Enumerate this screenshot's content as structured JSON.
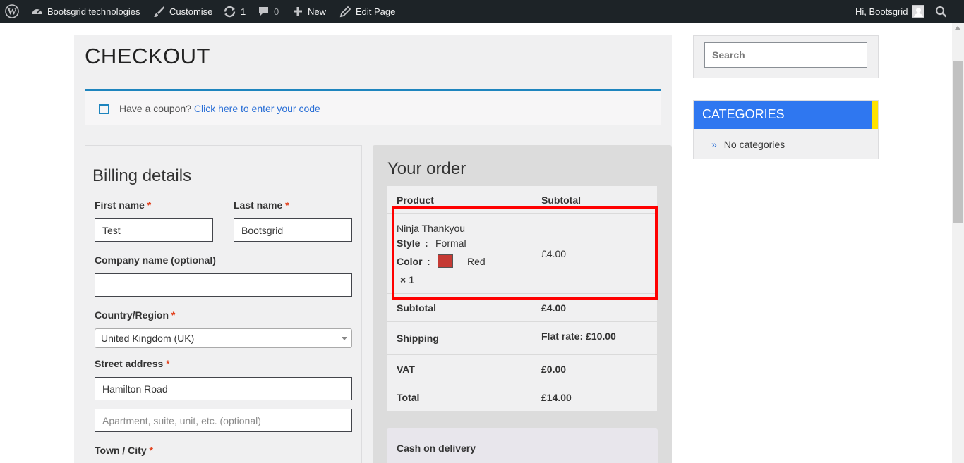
{
  "admin_bar": {
    "site_name": "Bootsgrid technologies",
    "customise": "Customise",
    "updates_count": "1",
    "comments_count": "0",
    "new": "New",
    "edit_page": "Edit Page",
    "greeting": "Hi, Bootsgrid"
  },
  "page": {
    "title": "CHECKOUT"
  },
  "coupon": {
    "prompt": "Have a coupon?",
    "link": "Click here to enter your code"
  },
  "billing": {
    "title": "Billing details",
    "required_mark": "*",
    "first_name": {
      "label": "First name",
      "value": "Test"
    },
    "last_name": {
      "label": "Last name",
      "value": "Bootsgrid"
    },
    "company": {
      "label": "Company name (optional)",
      "value": ""
    },
    "country": {
      "label": "Country/Region",
      "value": "United Kingdom (UK)"
    },
    "street": {
      "label": "Street address",
      "value": "Hamilton Road",
      "placeholder2": "Apartment, suite, unit, etc. (optional)"
    },
    "town": {
      "label": "Town / City"
    }
  },
  "order": {
    "title": "Your order",
    "col_product": "Product",
    "col_subtotal": "Subtotal",
    "item": {
      "name": "Ninja Thankyou",
      "style_label": "Style",
      "sep": ":",
      "style_value": "Formal",
      "color_label": "Color",
      "color_value": "Red",
      "color_hex": "#c53a34",
      "qty": "× 1",
      "price": "£4.00"
    },
    "subtotal": {
      "label": "Subtotal",
      "value": "£4.00"
    },
    "shipping": {
      "label": "Shipping",
      "value": "Flat rate: £10.00"
    },
    "vat": {
      "label": "VAT",
      "value": "£0.00"
    },
    "total": {
      "label": "Total",
      "value": "£14.00"
    },
    "payment_method": "Cash on delivery"
  },
  "sidebar": {
    "search_placeholder": "Search",
    "categories_title": "CATEGORIES",
    "no_categories": "No categories"
  },
  "colors": {
    "admin_bar": "#1d2327",
    "accent_blue": "#2f77f0",
    "accent_yellow": "#ffe200",
    "highlight": "#ff0000",
    "required": "#e2401c"
  }
}
